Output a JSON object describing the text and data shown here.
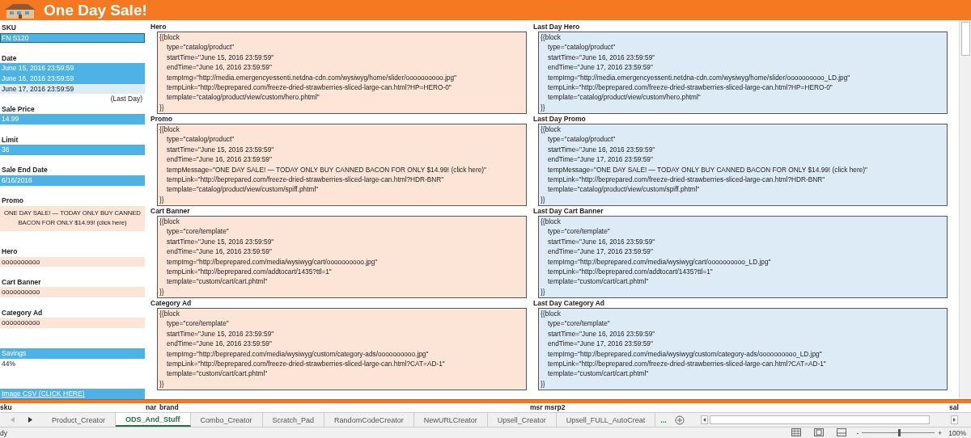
{
  "title": "One Day Sale!",
  "left_cells": [
    {
      "kind": "label",
      "text": "SKU",
      "selected": false
    },
    {
      "kind": "blue",
      "text": "FN S120",
      "selected": true
    },
    {
      "kind": "blank"
    },
    {
      "kind": "label",
      "text": "Date",
      "selected": false
    },
    {
      "kind": "blue",
      "text": "June 15, 2016 23:59:59",
      "selected": false
    },
    {
      "kind": "blue",
      "text": "June 16, 2016 23:59:59",
      "selected": false
    },
    {
      "kind": "light",
      "text": "June 17, 2016 23:59:59",
      "selected": false
    },
    {
      "kind": "note",
      "text": "(Last Day)",
      "selected": false
    },
    {
      "kind": "label",
      "text": "Sale Price",
      "selected": false
    },
    {
      "kind": "blue",
      "text": "14.99",
      "selected": false
    },
    {
      "kind": "blank"
    },
    {
      "kind": "label",
      "text": "Limit",
      "selected": false
    },
    {
      "kind": "blue",
      "text": "36",
      "selected": false
    },
    {
      "kind": "blank"
    },
    {
      "kind": "label",
      "text": "Sale End Date",
      "selected": false
    },
    {
      "kind": "blue",
      "text": "6/16/2016",
      "selected": false
    },
    {
      "kind": "blank"
    },
    {
      "kind": "label",
      "text": "Promo",
      "selected": false
    },
    {
      "kind": "peach_wrap",
      "text": "ONE DAY SALE! — TODAY ONLY BUY CANNED BACON FOR ONLY $14.99! (click here)",
      "selected": false
    },
    {
      "kind": "blank"
    },
    {
      "kind": "label",
      "text": "Hero",
      "selected": false
    },
    {
      "kind": "peach",
      "text": "oooooooooo",
      "selected": false
    },
    {
      "kind": "blank"
    },
    {
      "kind": "label",
      "text": "Cart Banner",
      "selected": false
    },
    {
      "kind": "peach",
      "text": "oooooooooo",
      "selected": false
    },
    {
      "kind": "blank"
    },
    {
      "kind": "label",
      "text": "Category Ad",
      "selected": false
    },
    {
      "kind": "peach",
      "text": "oooooooooo",
      "selected": false
    },
    {
      "kind": "blank"
    },
    {
      "kind": "blank"
    },
    {
      "kind": "blue_label",
      "text": "Savings",
      "selected": false
    },
    {
      "kind": "plain",
      "text": "44%",
      "selected": false
    },
    {
      "kind": "blank"
    },
    {
      "kind": "blank"
    },
    {
      "kind": "link",
      "text": "Image CSV (CLICK HERE)",
      "selected": false
    }
  ],
  "block_rows": [
    {
      "sale_day": {
        "title": "Hero",
        "lines": [
          "{{block",
          "type=\"catalog/product\"",
          "startTime=\"June 15, 2016 23:59:59\"",
          "endTime=\"June 16, 2016 23:59:59\"",
          "tempImg=\"http://media.emergencyessenti.netdna-cdn.com/wysiwyg/home/slider/oooooooooo.jpg\"",
          "tempLink=\"http://beprepared.com/freeze-dried-strawberries-sliced-large-can.html?HP=HERO-0\"",
          "template=\"catalog/product/view/custom/hero.phtml\"",
          "}}"
        ]
      },
      "last_day": {
        "title": "Last Day Hero",
        "lines": [
          "{{block",
          "type=\"catalog/product\"",
          "startTime=\"June 16, 2016 23:59:59\"",
          "endTime=\"June 17, 2016 23:59:59\"",
          "tempImg=\"http://media.emergencyessenti.netdna-cdn.com/wysiwyg/home/slider/oooooooooo_LD.jpg\"",
          "tempLink=\"http://beprepared.com/freeze-dried-strawberries-sliced-large-can.html?HP=HERO-0\"",
          "template=\"catalog/product/view/custom/hero.phtml\"",
          "}}"
        ]
      }
    },
    {
      "sale_day": {
        "title": "Promo",
        "lines": [
          "{{block",
          "type=\"catalog/product\"",
          "startTime=\"June 15, 2016 23:59:59\"",
          "endTime=\"June 16, 2016 23:59:59\"",
          "tempMessage=\"ONE DAY SALE! — TODAY ONLY BUY CANNED BACON FOR ONLY $14.99! (click here)\"",
          "tempLink=\"http://beprepared.com/freeze-dried-strawberries-sliced-large-can.html?HDR-BNR\"",
          "template=\"catalog/product/view/custom/spiff.phtml\"",
          "}}"
        ]
      },
      "last_day": {
        "title": "Last Day Promo",
        "lines": [
          "{{block",
          "type=\"catalog/product\"",
          "startTime=\"June 16, 2016 23:59:59\"",
          "endTime=\"June 17, 2016 23:59:59\"",
          "tempMessage=\"ONE DAY SALE! — TODAY ONLY BUY CANNED BACON FOR ONLY $14.99! (click here)\"",
          "tempLink=\"http://beprepared.com/freeze-dried-strawberries-sliced-large-can.html?HDR-BNR\"",
          "template=\"catalog/product/view/custom/spiff.phtml\"",
          "}}"
        ]
      }
    },
    {
      "sale_day": {
        "title": "Cart Banner",
        "lines": [
          "{{block",
          "type=\"core/template\"",
          "startTime=\"June 15, 2016 23:59:59\"",
          "endTime=\"June 16, 2016 23:59:59\"",
          "tempImg=\"http://beprepared.com/media/wysiwyg/cart/oooooooooo.jpg\"",
          "tempLink=\"http://beprepared.com/addtocart/1435?ttl=1\"",
          "template=\"custom/cart/cart.phtml\"",
          "}}"
        ]
      },
      "last_day": {
        "title": "Last Day Cart Banner",
        "lines": [
          "{{block",
          "type=\"core/template\"",
          "startTime=\"June 16, 2016 23:59:59\"",
          "endTime=\"June 17, 2016 23:59:59\"",
          "tempImg=\"http://beprepared.com/media/wysiwyg/cart/oooooooooo_LD.jpg\"",
          "tempLink=\"http://beprepared.com/addtocart/1435?ttl=1\"",
          "template=\"custom/cart/cart.phtml\"",
          "}}"
        ]
      }
    },
    {
      "sale_day": {
        "title": "Category Ad",
        "lines": [
          "{{block",
          "type=\"core/template\"",
          "startTime=\"June 15, 2016 23:59:59\"",
          "endTime=\"June 16, 2016 23:59:59\"",
          "tempImg=\"http://beprepared.com/media/wysiwyg/custom/category-ads/oooooooooo.jpg\"",
          "tempLink=\"http://beprepared.com/freeze-dried-strawberries-sliced-large-can.html?CAT=AD-1\"",
          "template=\"custom/cart/cart.phtml\"",
          "}}"
        ]
      },
      "last_day": {
        "title": "Last Day Category Ad",
        "lines": [
          "{{block",
          "type=\"core/template\"",
          "startTime=\"June 16, 2016 23:59:59\"",
          "endTime=\"June 17, 2016 23:59:59\"",
          "tempImg=\"http://beprepared.com/media/wysiwyg/custom/category-ads/oooooooooo_LD.jpg\"",
          "tempLink=\"http://beprepared.com/freeze-dried-strawberries-sliced-large-can.html?CAT=AD-1\"",
          "template=\"custom/cart/cart.phtml\"",
          "}}"
        ]
      }
    }
  ],
  "column_headers": [
    "sku",
    "nar",
    "brand",
    "msr",
    "msrp2",
    "sal"
  ],
  "sheet_tabs": [
    {
      "label": "Product_Creator",
      "selected": false
    },
    {
      "label": "ODS_And_Stuff",
      "selected": true
    },
    {
      "label": "Combo_Creator",
      "selected": false
    },
    {
      "label": "Scratch_Pad",
      "selected": false
    },
    {
      "label": "RandomCodeCreator",
      "selected": false
    },
    {
      "label": "NewURLCreator",
      "selected": false
    },
    {
      "label": "Upsell_Creator",
      "selected": false
    },
    {
      "label": "Upsell_FULL_AutoCreat",
      "selected": false
    }
  ],
  "more_tabs": "...",
  "status_bar": {
    "text": "dy",
    "zoom_out": "-",
    "zoom_in": "+",
    "zoom": {
      "level": 0.5,
      "reading": "100%"
    }
  }
}
